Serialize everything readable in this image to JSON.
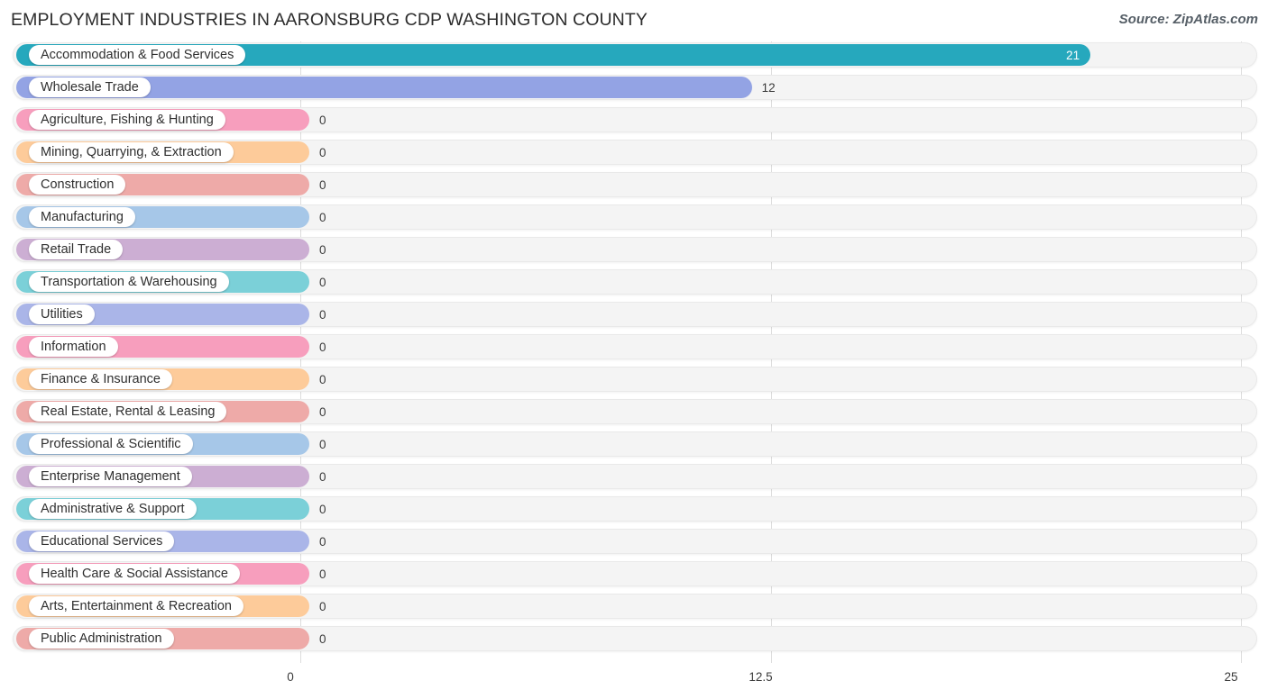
{
  "header": {
    "title": "EMPLOYMENT INDUSTRIES IN AARONSBURG CDP WASHINGTON COUNTY",
    "source": "Source: ZipAtlas.com"
  },
  "chart_data": {
    "type": "bar",
    "orientation": "horizontal",
    "title": "EMPLOYMENT INDUSTRIES IN AARONSBURG CDP WASHINGTON COUNTY",
    "xlabel": "",
    "ylabel": "",
    "xlim": [
      0,
      25
    ],
    "grid": true,
    "legend": "none",
    "xticks": [
      "0",
      "12.5",
      "25"
    ],
    "xtick_values": [
      0,
      12.5,
      25
    ],
    "categories": [
      "Accommodation & Food Services",
      "Wholesale Trade",
      "Agriculture, Fishing & Hunting",
      "Mining, Quarrying, & Extraction",
      "Construction",
      "Manufacturing",
      "Retail Trade",
      "Transportation & Warehousing",
      "Utilities",
      "Information",
      "Finance & Insurance",
      "Real Estate, Rental & Leasing",
      "Professional & Scientific",
      "Enterprise Management",
      "Administrative & Support",
      "Educational Services",
      "Health Care & Social Assistance",
      "Arts, Entertainment & Recreation",
      "Public Administration"
    ],
    "values": [
      21,
      12,
      0,
      0,
      0,
      0,
      0,
      0,
      0,
      0,
      0,
      0,
      0,
      0,
      0,
      0,
      0,
      0,
      0
    ],
    "value_labels": [
      "21",
      "12",
      "0",
      "0",
      "0",
      "0",
      "0",
      "0",
      "0",
      "0",
      "0",
      "0",
      "0",
      "0",
      "0",
      "0",
      "0",
      "0",
      "0"
    ],
    "colors": [
      "#26a8bd",
      "#93a3e4",
      "#f79ebd",
      "#fdcb9a",
      "#eeaaa8",
      "#a6c7e8",
      "#ccaed3",
      "#7bd0d8",
      "#aab5e8",
      "#f79ebd",
      "#fdcb9a",
      "#eeaaa8",
      "#a6c7e8",
      "#ccaed3",
      "#7bd0d8",
      "#aab5e8",
      "#f79ebd",
      "#fdcb9a",
      "#eeaaa8"
    ]
  }
}
